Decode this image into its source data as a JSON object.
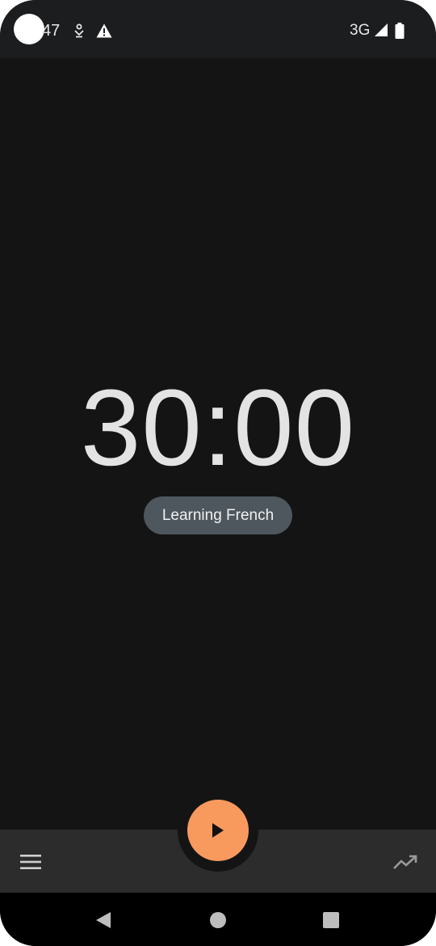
{
  "status_bar": {
    "time": "47",
    "network": "3G",
    "icons": [
      "app-notification-icon",
      "warning-icon",
      "signal-icon",
      "battery-icon"
    ]
  },
  "timer": {
    "display": "30:00",
    "task_label": "Learning French"
  },
  "bottom_bar": {
    "icons": [
      "menu-icon",
      "play-icon",
      "trending-up-icon"
    ]
  },
  "nav_bar": {
    "icons": [
      "back-icon",
      "home-icon",
      "recents-icon"
    ]
  },
  "colors": {
    "background": "#141414",
    "status_bar": "#1c1d1f",
    "bottom_bar": "#2c2c2c",
    "accent": "#f89a5e",
    "chip": "#4e575d",
    "text": "#e3e3e3"
  }
}
